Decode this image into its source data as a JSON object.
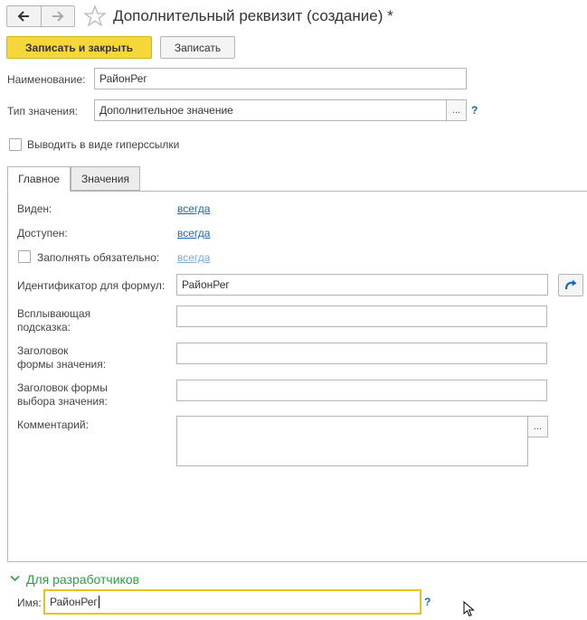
{
  "window": {
    "title": "Дополнительный реквизит (создание) *"
  },
  "toolbar": {
    "back_icon": "arrow-left-icon",
    "forward_icon": "arrow-right-icon",
    "favorite_icon": "star-icon",
    "save_close_label": "Записать и закрыть",
    "save_label": "Записать"
  },
  "form": {
    "name_label": "Наименование:",
    "name_value": "РайонРег",
    "type_label": "Тип значения:",
    "type_value": "Дополнительное значение",
    "select_button": "...",
    "help": "?",
    "hyperlink_checkbox_label": "Выводить в виде гиперссылки"
  },
  "tabs": [
    {
      "label": "Главное",
      "active": true
    },
    {
      "label": "Значения",
      "active": false
    }
  ],
  "main": {
    "visible_label": "Виден:",
    "visible_value": "всегда",
    "available_label": "Доступен:",
    "available_value": "всегда",
    "required_label": "Заполнять обязательно:",
    "required_value": "всегда",
    "formula_id_label": "Идентификатор для формул:",
    "formula_id_value": "РайонРег",
    "tooltip_label_line1": "Всплывающая",
    "tooltip_label_line2": "подсказка:",
    "tooltip_value": "",
    "value_form_title_line1": "Заголовок",
    "value_form_title_line2": "формы значения:",
    "value_form_title_value": "",
    "choice_form_title_line1": "Заголовок формы",
    "choice_form_title_line2": "выбора значения:",
    "choice_form_title_value": "",
    "comment_label": "Комментарий:",
    "comment_value": "",
    "comment_button": "..."
  },
  "developers": {
    "group_title": "Для разработчиков",
    "name_label": "Имя:",
    "name_value": "РайонРег",
    "help": "?"
  },
  "colors": {
    "primary_button": "#f5d73a",
    "link": "#1c68b5",
    "group_title": "#2f9d48",
    "focus_border": "#e8c21a"
  }
}
